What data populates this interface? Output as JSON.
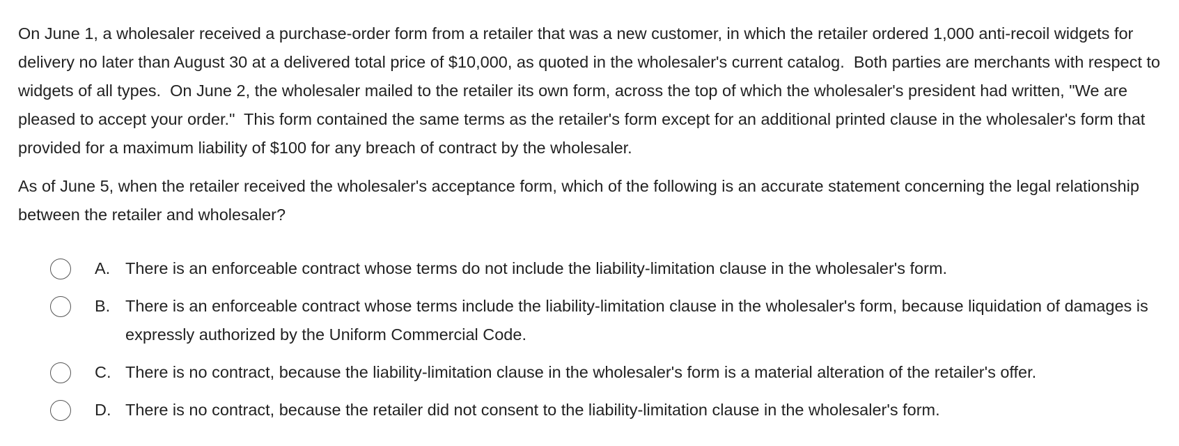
{
  "question": {
    "paragraphs": [
      "On June 1, a wholesaler received a purchase-order form from a retailer that was a new customer, in which the retailer ordered 1,000 anti-recoil widgets for delivery no later than August 30 at a delivered total price of $10,000, as quoted in the wholesaler's current catalog.  Both parties are merchants with respect to widgets of all types.  On June 2, the wholesaler mailed to the retailer its own form, across the top of which the wholesaler's president had written, \"We are pleased to accept your order.\"  This form contained the same terms as the retailer's form except for an additional printed clause in the wholesaler's form that provided for a maximum liability of $100 for any breach of contract by the wholesaler.",
      "As of June 5, when the retailer received the wholesaler's acceptance form, which of the following is an accurate statement concerning the legal relationship between the retailer and wholesaler?"
    ]
  },
  "options": [
    {
      "letter": "A.",
      "text": "There is an enforceable contract whose terms do not include the liability-limitation clause in the wholesaler's form."
    },
    {
      "letter": "B.",
      "text": "There is an enforceable contract whose terms include the liability-limitation clause in the wholesaler's form, because liquidation of damages is expressly authorized by the Uniform Commercial Code."
    },
    {
      "letter": "C.",
      "text": "There is no contract, because the liability-limitation clause in the wholesaler's form is a material alteration of the retailer's offer."
    },
    {
      "letter": "D.",
      "text": "There is no contract, because the retailer did not consent to the liability-limitation clause in the wholesaler's form."
    }
  ]
}
